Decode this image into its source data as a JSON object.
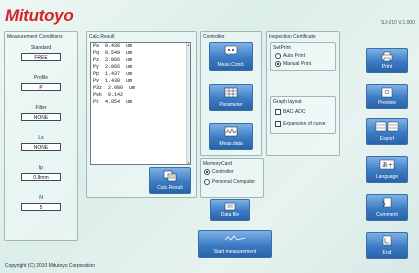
{
  "header": {
    "logo": "Mitutoyo",
    "version": "SJ-210 V.1.000"
  },
  "measurement_conditions": {
    "title": "Measurement Conditions",
    "fields": [
      {
        "label": "Standard",
        "value": "FREE"
      },
      {
        "label": "Profile",
        "value": "P"
      },
      {
        "label": "Filter",
        "value": "NONE"
      },
      {
        "label": "Ls",
        "value": "NONE"
      },
      {
        "label": "lp",
        "value": "0.8mm"
      },
      {
        "label": "N",
        "value": "5"
      }
    ]
  },
  "calc_result": {
    "title": "Calc.Result",
    "lines": [
      "Pa  0.436  um",
      "Pq  0.549  um",
      "Pz  2.866  um",
      "Py  2.866  um",
      "Pp  1.437  um",
      "Pv  1.430  um",
      "P3z  2.080  um",
      "Psk  0.142",
      "Pt  4.054  um"
    ],
    "button_label": "Calc.Result"
  },
  "controller": {
    "title": "Controller",
    "buttons": {
      "meas_cond": "Meas.Cond.",
      "parameter": "Parameter",
      "meas_data": "Meas.data"
    }
  },
  "memory_card": {
    "title": "MemoryCard",
    "options": [
      {
        "label": "Controller",
        "selected": true
      },
      {
        "label": "Personal Computer",
        "selected": false
      }
    ],
    "button_label": "Data file"
  },
  "inspection": {
    "title": "Inspection Certificate",
    "setprint": {
      "title": "SetPrint",
      "options": [
        {
          "label": "Auto Print",
          "selected": false
        },
        {
          "label": "Manual Print",
          "selected": true
        }
      ]
    },
    "graph_layout": {
      "title": "Graph layout",
      "options": [
        {
          "label": "BAC·ADC",
          "checked": false
        },
        {
          "label": "Expansion of curve",
          "checked": false
        }
      ]
    }
  },
  "right_buttons": {
    "print": "Print",
    "preview": "Preview",
    "export": "Export",
    "language": "Language",
    "comment": "Comment",
    "end": "End"
  },
  "start_button": "Start measurement",
  "footer": {
    "copyright": "Copyright (C) 2010 Mitutoyo Corporation"
  },
  "colors": {
    "logo": "#d4232b",
    "button_top": "#7fb2e6",
    "button_bottom": "#2a62a8",
    "background": "#e2f1ee"
  }
}
